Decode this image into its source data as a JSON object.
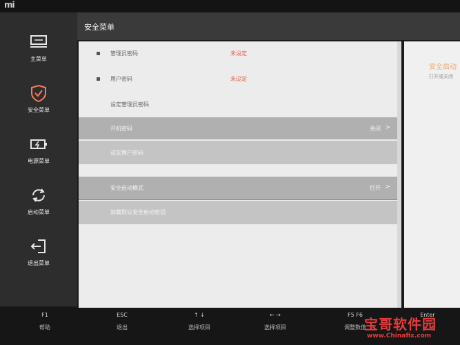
{
  "brand": {
    "logo": "mi"
  },
  "header": {
    "title": "安全菜单"
  },
  "sidebar": {
    "items": [
      {
        "label": "主菜单",
        "icon": "monitor-icon"
      },
      {
        "label": "安全菜单",
        "icon": "shield-icon"
      },
      {
        "label": "电源菜单",
        "icon": "battery-icon"
      },
      {
        "label": "启动菜单",
        "icon": "restart-icon"
      },
      {
        "label": "退出菜单",
        "icon": "exit-icon"
      }
    ]
  },
  "menu": {
    "rows": [
      {
        "label": "管理员密码",
        "value": "未设定"
      },
      {
        "label": "用户密码",
        "value": "未设定"
      },
      {
        "label": "设定管理员密码"
      },
      {
        "label": "开机密码",
        "right": "关闭",
        "chevron": ">"
      },
      {
        "label": "设定用户密码"
      },
      {
        "label": "安全启动模式",
        "right": "打开",
        "chevron": ">"
      },
      {
        "label": "加载默认安全启动密钥"
      }
    ]
  },
  "help_panel": {
    "title": "安全启动",
    "subtitle": "打开或关闭"
  },
  "footer": {
    "items": [
      {
        "key": "F1",
        "desc": "帮助"
      },
      {
        "key": "ESC",
        "desc": "退出"
      },
      {
        "key": "↑  ↓",
        "desc": "选择项目"
      },
      {
        "key": "←  →",
        "desc": "选择项目"
      },
      {
        "key": "F5   F6",
        "desc": "调整数值"
      },
      {
        "key": "Enter",
        "desc": ""
      }
    ]
  },
  "watermark": {
    "text": "宝哥软件园",
    "sub": "www.Chinafix.com"
  },
  "colors": {
    "accent_red": "#e8604c",
    "accent_orange": "#f0a868",
    "sidebar_bg": "#2d2d2d"
  }
}
